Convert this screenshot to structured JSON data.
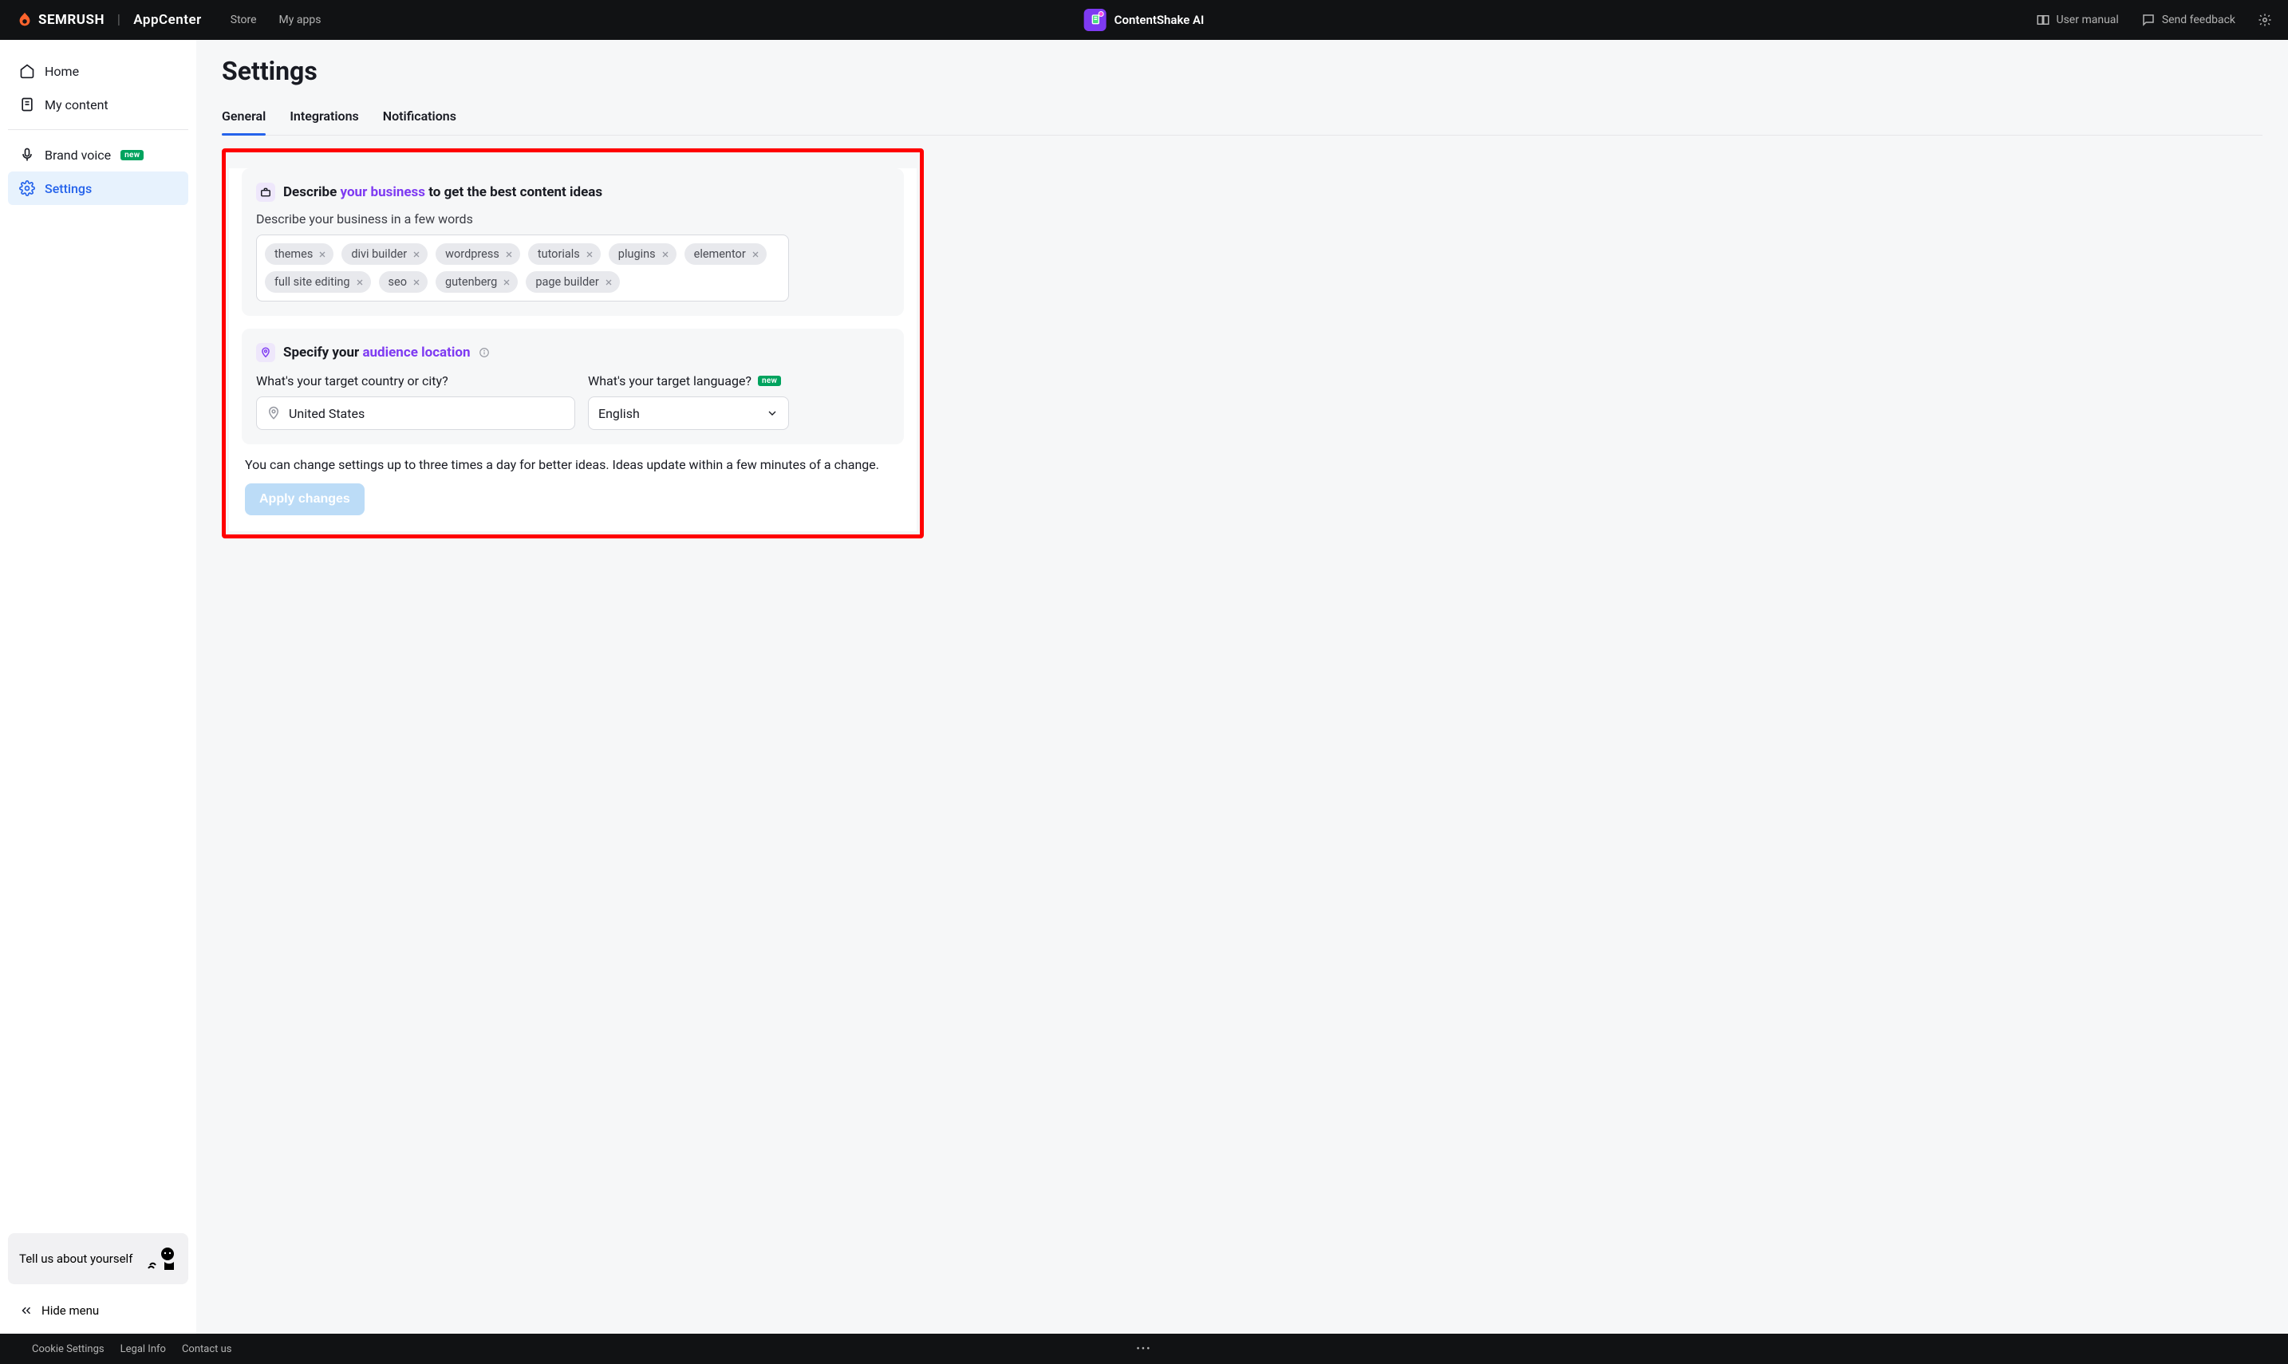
{
  "header": {
    "brand": "SEMRUSH",
    "appcenter": "AppCenter",
    "store": "Store",
    "myapps": "My apps",
    "app_name": "ContentShake AI",
    "user_manual": "User manual",
    "send_feedback": "Send feedback"
  },
  "sidebar": {
    "home": "Home",
    "my_content": "My content",
    "brand_voice": "Brand voice",
    "brand_voice_badge": "new",
    "settings": "Settings",
    "promo": "Tell us about yourself",
    "hide_menu": "Hide menu"
  },
  "page": {
    "title": "Settings",
    "tabs": {
      "general": "General",
      "integrations": "Integrations",
      "notifications": "Notifications"
    }
  },
  "business_section": {
    "title_pre": "Describe ",
    "title_hl": "your business",
    "title_post": " to get the best content ideas",
    "subtitle": "Describe your business in a few words",
    "tags": [
      "themes",
      "divi builder",
      "wordpress",
      "tutorials",
      "plugins",
      "elementor",
      "full site editing",
      "seo",
      "gutenberg",
      "page builder"
    ]
  },
  "audience_section": {
    "title_pre": "Specify your ",
    "title_hl": "audience location",
    "country_label": "What's your target country or city?",
    "country_value": "United States",
    "language_label": "What's your target language?",
    "language_badge": "new",
    "language_value": "English"
  },
  "note": "You can change settings up to three times a day for better ideas. Ideas update within a few minutes of a change.",
  "apply": "Apply changes",
  "footer": {
    "cookie": "Cookie Settings",
    "legal": "Legal Info",
    "contact": "Contact us"
  }
}
